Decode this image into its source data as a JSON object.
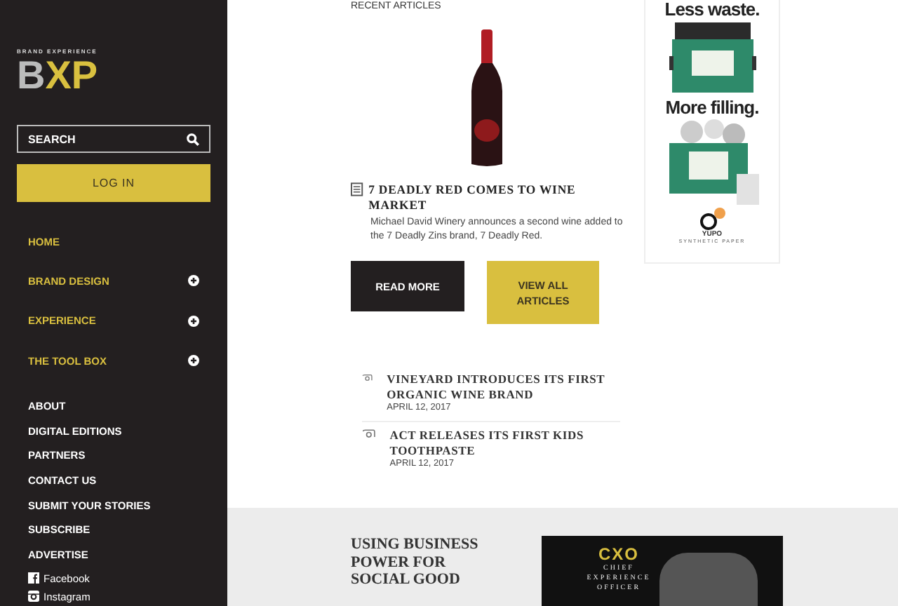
{
  "sidebar": {
    "logo": {
      "tagline": "BRAND EXPERIENCE",
      "letters": [
        "B",
        "X",
        "P"
      ]
    },
    "search": {
      "placeholder": "SEARCH"
    },
    "login_button": "LOG IN",
    "primary_nav": [
      {
        "label": "HOME",
        "expandable": false
      },
      {
        "label": "BRAND DESIGN",
        "expandable": true
      },
      {
        "label": "EXPERIENCE",
        "expandable": true
      },
      {
        "label": "THE TOOL BOX",
        "expandable": true
      }
    ],
    "secondary_nav": [
      "ABOUT",
      "DIGITAL EDITIONS",
      "PARTNERS",
      "CONTACT US",
      "SUBMIT YOUR STORIES",
      "SUBSCRIBE",
      "ADVERTISE"
    ],
    "social": [
      {
        "kind": "facebook",
        "label": "Facebook"
      },
      {
        "kind": "instagram",
        "label": "Instagram"
      }
    ]
  },
  "recent_articles": {
    "heading": "RECENT ARTICLES",
    "featured": {
      "title": "7 DEADLY RED COMES TO WINE MARKET",
      "summary": "Michael David Winery announces a second wine added to the 7 Deadly Zins brand, 7 Deadly Red."
    },
    "buttons": [
      {
        "label": "READ MORE",
        "kind": "dark"
      },
      {
        "label": "VIEW ALL ARTICLES",
        "kind": "accent"
      }
    ],
    "list": [
      {
        "title": "VINEYARD INTRODUCES ITS FIRST ORGANIC WINE BRAND",
        "date": "APRIL 12, 2017"
      },
      {
        "title": "ACT RELEASES ITS FIRST KIDS TOOTHPASTE",
        "date": "APRIL 12, 2017"
      }
    ]
  },
  "advertisement": {
    "headline_1": "Less waste.",
    "headline_2": "More filling.",
    "brand": "YUPO",
    "brand_sub": "SYNTHETIC PAPER"
  },
  "feature_band": {
    "title": "USING BUSINESS POWER FOR SOCIAL GOOD",
    "banner": {
      "logo": "CXO",
      "caption": "CHIEF EXPERIENCE OFFICER"
    }
  }
}
